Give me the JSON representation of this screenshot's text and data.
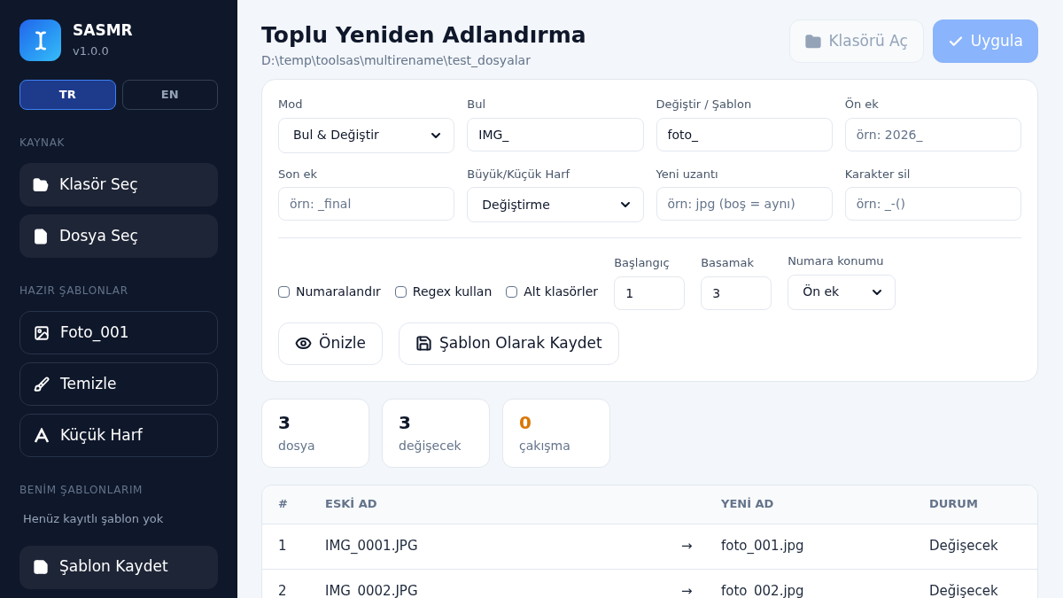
{
  "sidebar": {
    "app": {
      "name": "SASMR",
      "version": "v1.0.0"
    },
    "languages": [
      {
        "label": "TR",
        "selected": true
      },
      {
        "label": "EN",
        "selected": false
      }
    ],
    "sections": [
      {
        "title": "KAYNAK",
        "kind": "filled",
        "items": [
          "Klasör Seç",
          "Dosya Seç"
        ]
      },
      {
        "title": "HAZIR ŞABLONLAR",
        "kind": "outlined",
        "items": [
          "Foto_001",
          "Temizle",
          "Küçük Harf"
        ]
      },
      {
        "title": "BENİM ŞABLONLARIM",
        "kind": "filled",
        "empty_text": "Henüz kayıtlı şablon yok",
        "items": [
          "Şablon Kaydet"
        ]
      }
    ]
  },
  "header": {
    "title": "Toplu Yeniden Adlandırma",
    "path": "D:\\temp\\toolsas\\multirename\\test_dosyalar",
    "buttons": [
      {
        "label": "Klasörü Aç",
        "kind": "secondary",
        "disabled": true
      },
      {
        "label": "Uygula",
        "kind": "primary",
        "disabled": true
      }
    ]
  },
  "form": {
    "fields": [
      {
        "label": "Mod",
        "kind": "select",
        "value": "Bul & Değiştir"
      },
      {
        "label": "Bul",
        "kind": "input",
        "value": "IMG_"
      },
      {
        "label": "Değiştir / Şablon",
        "kind": "input",
        "value": "foto_"
      },
      {
        "label": "Ön ek",
        "kind": "input",
        "placeholder": "örn: 2026_"
      },
      {
        "label": "Son ek",
        "kind": "input",
        "placeholder": "örn: _final"
      },
      {
        "label": "Büyük/Küçük Harf",
        "kind": "select",
        "value": "Değiştirme"
      },
      {
        "label": "Yeni uzantı",
        "kind": "input",
        "placeholder": "örn: jpg (boş = aynı)"
      },
      {
        "label": "Karakter sil",
        "kind": "input",
        "placeholder": "örn: _-()"
      }
    ],
    "checkboxes": [
      {
        "label": "Numaralandır",
        "checked": false
      },
      {
        "label": "Regex kullan",
        "checked": false
      },
      {
        "label": "Alt klasörler",
        "checked": false
      }
    ],
    "numbering": [
      {
        "label": "Başlangıç",
        "kind": "input",
        "value": "1"
      },
      {
        "label": "Basamak",
        "kind": "input",
        "value": "3"
      },
      {
        "label": "Numara konumu",
        "kind": "select",
        "value": "Ön ek"
      }
    ],
    "buttons": [
      "Önizle",
      "Şablon Olarak Kaydet"
    ]
  },
  "stats": [
    {
      "value": "3",
      "label": "dosya",
      "color": "#0f172a"
    },
    {
      "value": "3",
      "label": "değişecek",
      "color": "#0f172a"
    },
    {
      "value": "0",
      "label": "çakışma",
      "color": "#d97706"
    }
  ],
  "table": {
    "columns": [
      "#",
      "ESKİ AD",
      "YENİ AD",
      "DURUM"
    ],
    "rows": [
      {
        "index": "1",
        "old": "IMG_0001.JPG",
        "arrow": "→",
        "new": "foto_001.jpg",
        "status": "Değişecek"
      },
      {
        "index": "2",
        "old": "IMG_0002.JPG",
        "arrow": "→",
        "new": "foto_002.jpg",
        "status": "Değişecek"
      }
    ]
  }
}
